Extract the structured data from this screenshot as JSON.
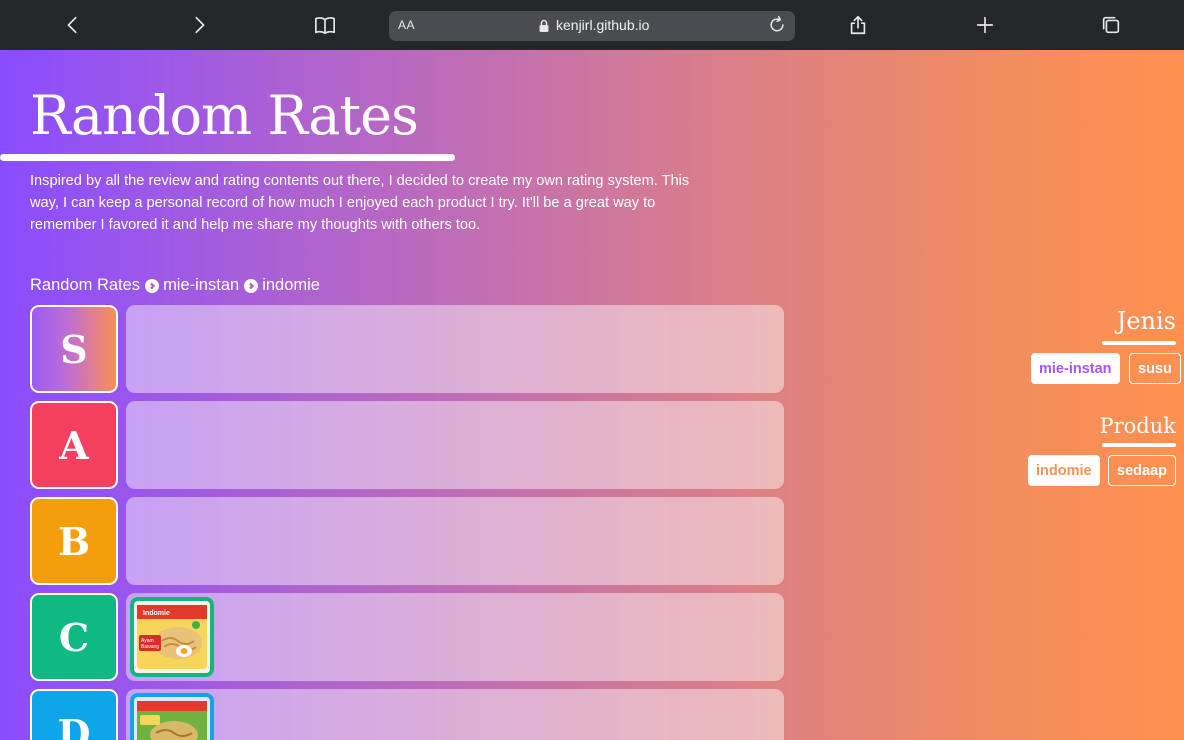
{
  "browser": {
    "text_size_label": "AA",
    "url": "kenjirl.github.io"
  },
  "page": {
    "title": "Random Rates",
    "intro": "Inspired by all the review and rating contents out there, I decided to create my own rating system. This way, I can keep a personal record of how much I enjoyed each product I try. It'll be a great way to remember I favored it and help me share my thoughts with others too.",
    "breadcrumb": [
      "Random Rates",
      "mie-instan",
      "indomie"
    ]
  },
  "tiers": [
    {
      "label": "S",
      "color": "gradient-purple-orange",
      "items": []
    },
    {
      "label": "A",
      "color": "#f43f5e",
      "items": []
    },
    {
      "label": "B",
      "color": "#f59e0b",
      "items": []
    },
    {
      "label": "C",
      "color": "#10b981",
      "items": [
        {
          "name": "indomie-ayam-bawang-thumbnail",
          "border": "#12b57c"
        }
      ]
    },
    {
      "label": "D",
      "color": "#0ea5e9",
      "items": [
        {
          "name": "indomie-thumbnail",
          "border": "#12a4e4"
        }
      ]
    }
  ],
  "sidebar": {
    "jenis": {
      "title": "Jenis",
      "tags": [
        {
          "label": "mie-instan",
          "active": true,
          "color": "#a855f7"
        },
        {
          "label": "susu",
          "active": false
        }
      ]
    },
    "produk": {
      "title": "Produk",
      "tags": [
        {
          "label": "indomie",
          "active": true,
          "color": "#f79355"
        },
        {
          "label": "sedaap",
          "active": false
        }
      ]
    }
  }
}
